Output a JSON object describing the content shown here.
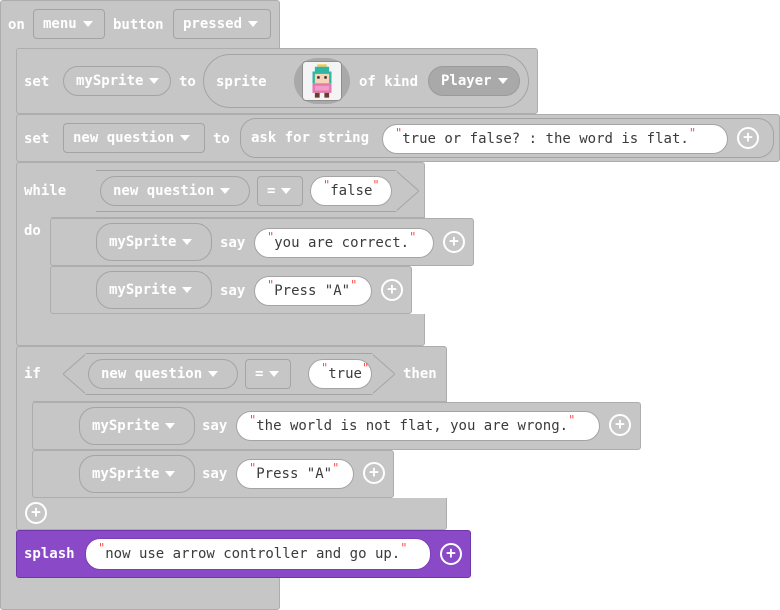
{
  "event": {
    "on": "on",
    "button": "menu",
    "button_word": "button",
    "action": "pressed"
  },
  "set_sprite": {
    "set": "set",
    "variable": "mySprite",
    "to": "to",
    "sprite": "sprite",
    "of_kind": "of kind",
    "kind": "Player"
  },
  "set_question": {
    "set": "set",
    "variable": "new question",
    "to": "to",
    "ask": "ask for string",
    "prompt": "true or false? : the word is flat."
  },
  "while_block": {
    "while": "while",
    "do": "do",
    "lhs": "new question",
    "op": "=",
    "rhs": "false",
    "body": [
      {
        "sprite": "mySprite",
        "say": "say",
        "text": "you are correct."
      },
      {
        "sprite": "mySprite",
        "say": "say",
        "text": "Press \"A\""
      }
    ]
  },
  "if_block": {
    "if": "if",
    "then": "then",
    "lhs": "new question",
    "op": "=",
    "rhs": "true",
    "body": [
      {
        "sprite": "mySprite",
        "say": "say",
        "text": "the world is not flat, you are wrong."
      },
      {
        "sprite": "mySprite",
        "say": "say",
        "text": "Press \"A\""
      }
    ]
  },
  "splash": {
    "label": "splash",
    "text": "now use arrow controller and go up."
  },
  "colors": {
    "block_gray": "#c6c6c6",
    "splash_purple": "#8a4ac8",
    "quote_red": "#ff4d4d"
  },
  "icons": {
    "dropdown": "chevron-down-icon",
    "add": "plus-circle-icon",
    "sprite": "player-sprite-image"
  }
}
